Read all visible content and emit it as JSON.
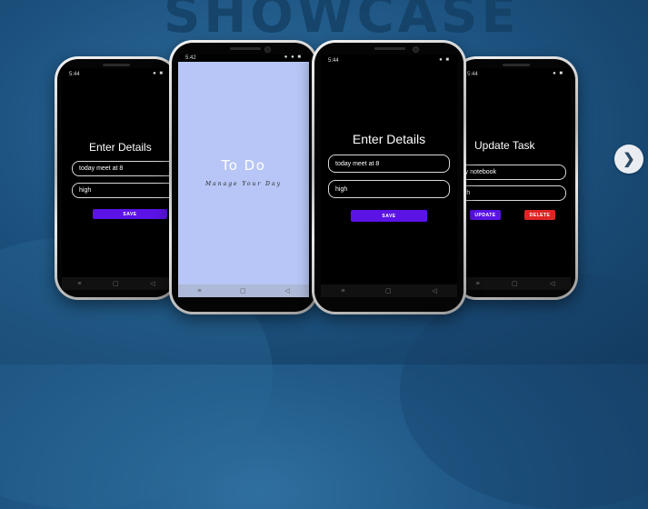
{
  "banner": {
    "heading": "SHOWCASE"
  },
  "phones": {
    "left": {
      "time": "5:44",
      "status_icons": "● ■",
      "title": "Enter Details",
      "field1": "today meet at 8",
      "field2": "high",
      "save": "SAVE"
    },
    "splash": {
      "time": "5:42",
      "status_icons": "● ● ■",
      "title": "To Do",
      "subtitle": "Manage Your Day"
    },
    "center": {
      "time": "5:44",
      "status_icons": "● ■",
      "title": "Enter Details",
      "field1": "today meet at 8",
      "field2": "high",
      "save": "SAVE"
    },
    "right": {
      "time": "5:44",
      "status_icons": "● ■",
      "title": "Update Task",
      "field1": "buy notebook",
      "field2": "high",
      "update": "UPDATE",
      "delete": "DELETE"
    }
  },
  "navbar": {
    "menu": "≡",
    "home": "▢",
    "back": "◁"
  },
  "carousel": {
    "next_glyph": "❯"
  },
  "colors": {
    "background": "#1e5583",
    "button_purple": "#5b13e6",
    "button_red": "#e02424",
    "splash_bg": "#b7c6f6"
  }
}
